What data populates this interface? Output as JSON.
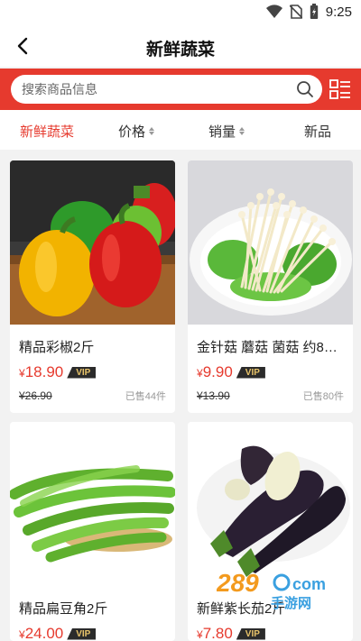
{
  "status": {
    "time": "9:25"
  },
  "nav": {
    "title": "新鲜蔬菜"
  },
  "search": {
    "placeholder": "搜索商品信息"
  },
  "filters": [
    {
      "label": "新鲜蔬菜"
    },
    {
      "label": "价格"
    },
    {
      "label": "销量"
    },
    {
      "label": "新品"
    }
  ],
  "products": [
    {
      "name": "精品彩椒2斤",
      "currency": "¥",
      "price": "18.90",
      "vip": "VIP",
      "old_price": "¥26.90",
      "sold": "已售44件"
    },
    {
      "name": "金针菇 蘑菇 菌菇 约8…",
      "currency": "¥",
      "price": "9.90",
      "vip": "VIP",
      "old_price": "¥13.90",
      "sold": "已售80件"
    },
    {
      "name": "精品扁豆角2斤",
      "currency": "¥",
      "price": "24.00",
      "vip": "VIP",
      "old_price": "",
      "sold": ""
    },
    {
      "name": "新鲜紫长茄2斤",
      "currency": "¥",
      "price": "7.80",
      "vip": "VIP",
      "old_price": "",
      "sold": ""
    }
  ],
  "watermark": {
    "brand": "289",
    "suffix": "com",
    "tagline": "手游网"
  },
  "colors": {
    "accent": "#e63a2e",
    "vip_bg": "#2b2b2b",
    "vip_text": "#e9c46a"
  }
}
